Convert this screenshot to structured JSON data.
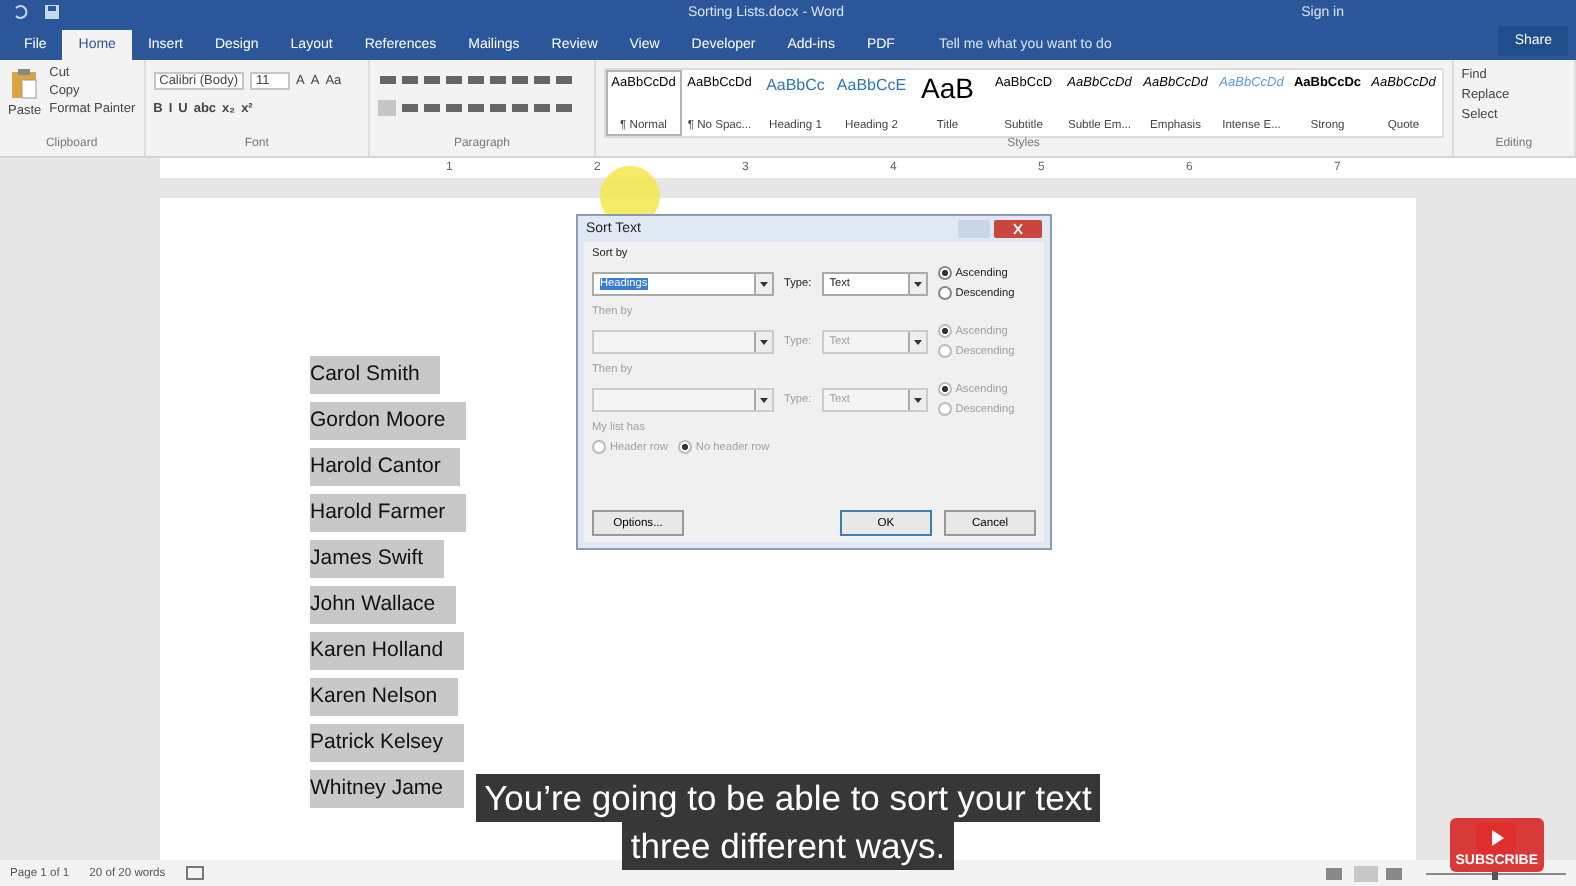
{
  "title_bar": {
    "title": "Sorting Lists.docx - Word",
    "sign_in": "Sign in"
  },
  "tabs": [
    {
      "label": "File",
      "selected": false
    },
    {
      "label": "Home",
      "selected": true
    },
    {
      "label": "Insert",
      "selected": false
    },
    {
      "label": "Design",
      "selected": false
    },
    {
      "label": "Layout",
      "selected": false
    },
    {
      "label": "References",
      "selected": false
    },
    {
      "label": "Mailings",
      "selected": false
    },
    {
      "label": "Review",
      "selected": false
    },
    {
      "label": "View",
      "selected": false
    },
    {
      "label": "Developer",
      "selected": false
    },
    {
      "label": "Add-ins",
      "selected": false
    },
    {
      "label": "PDF",
      "selected": false
    }
  ],
  "tell_me": "Tell me what you want to do",
  "share": "Share",
  "clipboard": {
    "paste": "Paste",
    "items": [
      "Cut",
      "Copy",
      "Format Painter"
    ],
    "label": "Clipboard"
  },
  "font": {
    "name": "Calibri (Body)",
    "size": "11",
    "row1": [
      "A",
      "A",
      "Aa"
    ],
    "row2": [
      "B",
      "I",
      "U",
      "abc",
      "x₂",
      "x²"
    ],
    "label": "Font"
  },
  "paragraph": {
    "label": "Paragraph"
  },
  "styles": {
    "label": "Styles",
    "items": [
      {
        "preview": "AaBbCcDd",
        "name": "¶ Normal",
        "selected": true,
        "kind": "normal"
      },
      {
        "preview": "AaBbCcDd",
        "name": "¶ No Spac...",
        "selected": false,
        "kind": "normal"
      },
      {
        "preview": "AaBbCc",
        "name": "Heading 1",
        "selected": false,
        "kind": "heading"
      },
      {
        "preview": "AaBbCcE",
        "name": "Heading 2",
        "selected": false,
        "kind": "heading"
      },
      {
        "preview": "AaB",
        "name": "Title",
        "selected": false,
        "kind": "title"
      },
      {
        "preview": "AaBbCcD",
        "name": "Subtitle",
        "selected": false,
        "kind": "normal"
      },
      {
        "preview": "AaBbCcDd",
        "name": "Subtle Em...",
        "selected": false,
        "kind": "italic"
      },
      {
        "preview": "AaBbCcDd",
        "name": "Emphasis",
        "selected": false,
        "kind": "italic"
      },
      {
        "preview": "AaBbCcDd",
        "name": "Intense E...",
        "selected": false,
        "kind": "intense"
      },
      {
        "preview": "AaBbCcDc",
        "name": "Strong",
        "selected": false,
        "kind": "strong"
      },
      {
        "preview": "AaBbCcDd",
        "name": "Quote",
        "selected": false,
        "kind": "italic"
      }
    ]
  },
  "editing": {
    "items": [
      "Find",
      "Replace",
      "Select"
    ],
    "label": "Editing"
  },
  "ruler": [
    "1",
    "2",
    "3",
    "4",
    "5",
    "6",
    "7"
  ],
  "document": {
    "names": [
      "Carol Smith",
      "Gordon Moore",
      "Harold Cantor",
      "Harold Farmer",
      "James Swift",
      "John Wallace",
      "Karen Holland",
      "Karen Nelson",
      "Patrick Kelsey",
      "Whitney Jame"
    ]
  },
  "dialog": {
    "title": "Sort Text",
    "sections": [
      {
        "label": "Sort by",
        "field": "Headings",
        "type_label": "Type:",
        "type": "Text",
        "disabled": false,
        "options": [
          {
            "label": "Ascending",
            "selected": true
          },
          {
            "label": "Descending",
            "selected": false
          }
        ]
      },
      {
        "label": "Then by",
        "type_label": "Type:",
        "type": "Text",
        "disabled": true,
        "options": [
          {
            "label": "Ascending",
            "selected": true
          },
          {
            "label": "Descending",
            "selected": false
          }
        ]
      },
      {
        "label": "Then by",
        "type_label": "Type:",
        "type": "Text",
        "disabled": true,
        "options": [
          {
            "label": "Ascending",
            "selected": true
          },
          {
            "label": "Descending",
            "selected": false
          }
        ]
      }
    ],
    "list_has": {
      "label": "My list has",
      "disabled": true,
      "options": [
        {
          "label": "Header row",
          "selected": false
        },
        {
          "label": "No header row",
          "selected": true
        }
      ]
    },
    "buttons": [
      "Options...",
      "OK",
      "Cancel"
    ]
  },
  "subtitles": [
    "You’re going to be able to sort your text",
    "three different ways."
  ],
  "subscribe": "SUBSCRIBE",
  "status_bar": {
    "page": "Page 1 of 1",
    "words": "20 of 20 words"
  }
}
